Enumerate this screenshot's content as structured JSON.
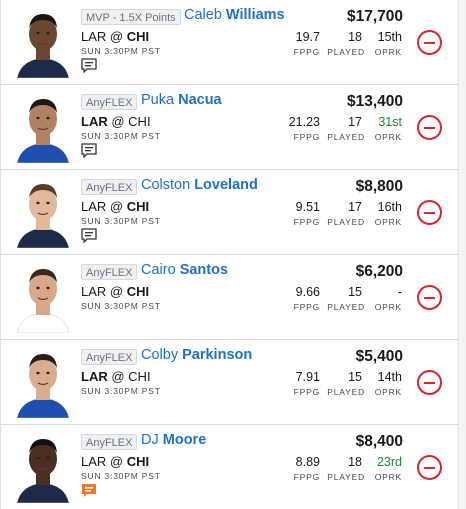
{
  "colors": {
    "link": "#1f6fd1",
    "remove": "#d9252e",
    "rank_good": "#1a8a2e",
    "rank_neutral": "#1a1a1a"
  },
  "stat_labels": {
    "fppg": "FPPG",
    "played": "PLAYED",
    "oprk": "OPRK"
  },
  "roster": [
    {
      "slot": "MVP - 1.5X Points",
      "first_name": "Caleb",
      "last_name": "Williams",
      "salary": "$17,700",
      "team": "LAR",
      "at": "@",
      "opp": "CHI",
      "bold_side": "opp",
      "game_time": "SUN 3:30PM PST",
      "fppg": "19.7",
      "played": "18",
      "oprk": "15th",
      "oprk_color": "#1a1a1a",
      "note_icon": "note-icon"
    },
    {
      "slot": "AnyFLEX",
      "first_name": "Puka",
      "last_name": "Nacua",
      "salary": "$13,400",
      "team": "LAR",
      "at": "@",
      "opp": "CHI",
      "bold_side": "team",
      "game_time": "SUN 3:30PM PST",
      "fppg": "21.23",
      "played": "17",
      "oprk": "31st",
      "oprk_color": "#1a8a2e",
      "note_icon": "note-icon"
    },
    {
      "slot": "AnyFLEX",
      "first_name": "Colston",
      "last_name": "Loveland",
      "salary": "$8,800",
      "team": "LAR",
      "at": "@",
      "opp": "CHI",
      "bold_side": "opp",
      "game_time": "SUN 3:30PM PST",
      "fppg": "9.51",
      "played": "17",
      "oprk": "16th",
      "oprk_color": "#1a1a1a",
      "note_icon": "note-icon"
    },
    {
      "slot": "AnyFLEX",
      "first_name": "Cairo",
      "last_name": "Santos",
      "salary": "$6,200",
      "team": "LAR",
      "at": "@",
      "opp": "CHI",
      "bold_side": "opp",
      "game_time": "SUN 3:30PM PST",
      "fppg": "9.66",
      "played": "15",
      "oprk": "-",
      "oprk_color": "#1a1a1a",
      "note_icon": ""
    },
    {
      "slot": "AnyFLEX",
      "first_name": "Colby",
      "last_name": "Parkinson",
      "salary": "$5,400",
      "team": "LAR",
      "at": "@",
      "opp": "CHI",
      "bold_side": "team",
      "game_time": "SUN 3:30PM PST",
      "fppg": "7.91",
      "played": "15",
      "oprk": "14th",
      "oprk_color": "#1a1a1a",
      "note_icon": ""
    },
    {
      "slot": "AnyFLEX",
      "first_name": "DJ",
      "last_name": "Moore",
      "salary": "$8,400",
      "team": "LAR",
      "at": "@",
      "opp": "CHI",
      "bold_side": "opp",
      "game_time": "SUN 3:30PM PST",
      "fppg": "8.89",
      "played": "18",
      "oprk": "23rd",
      "oprk_color": "#1a8a2e",
      "note_icon": "news-alert-icon"
    }
  ]
}
